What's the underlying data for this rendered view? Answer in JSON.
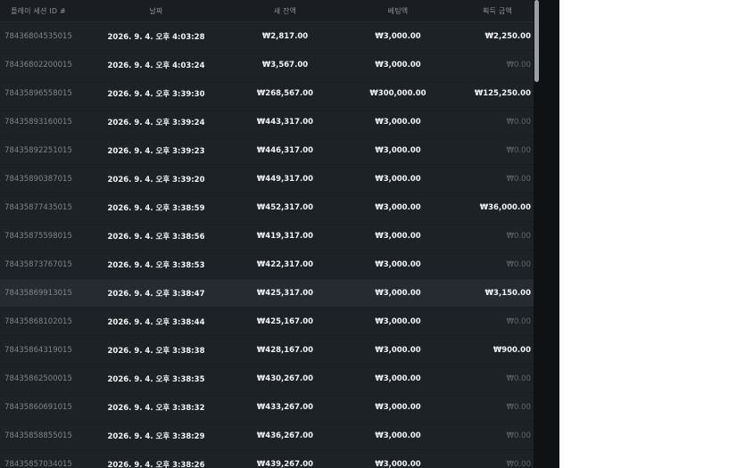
{
  "table": {
    "headers": {
      "id": "플레이 세션 ID #",
      "date": "날짜",
      "balance": "새 잔액",
      "bet": "베팅액",
      "win": "획득 금액"
    },
    "rows": [
      {
        "id": "78436804535015",
        "date": "2026. 9. 4. 오후 4:03:28",
        "balance": "₩2,817.00",
        "bet": "₩3,000.00",
        "win": "₩2,250.00"
      },
      {
        "id": "78436802200015",
        "date": "2026. 9. 4. 오후 4:03:24",
        "balance": "₩3,567.00",
        "bet": "₩3,000.00",
        "win": "₩0.00"
      },
      {
        "id": "78435896558015",
        "date": "2026. 9. 4. 오후 3:39:30",
        "balance": "₩268,567.00",
        "bet": "₩300,000.00",
        "win": "₩125,250.00"
      },
      {
        "id": "78435893160015",
        "date": "2026. 9. 4. 오후 3:39:24",
        "balance": "₩443,317.00",
        "bet": "₩3,000.00",
        "win": "₩0.00"
      },
      {
        "id": "78435892251015",
        "date": "2026. 9. 4. 오후 3:39:23",
        "balance": "₩446,317.00",
        "bet": "₩3,000.00",
        "win": "₩0.00"
      },
      {
        "id": "78435890387015",
        "date": "2026. 9. 4. 오후 3:39:20",
        "balance": "₩449,317.00",
        "bet": "₩3,000.00",
        "win": "₩0.00"
      },
      {
        "id": "78435877435015",
        "date": "2026. 9. 4. 오후 3:38:59",
        "balance": "₩452,317.00",
        "bet": "₩3,000.00",
        "win": "₩36,000.00"
      },
      {
        "id": "78435875598015",
        "date": "2026. 9. 4. 오후 3:38:56",
        "balance": "₩419,317.00",
        "bet": "₩3,000.00",
        "win": "₩0.00"
      },
      {
        "id": "78435873767015",
        "date": "2026. 9. 4. 오후 3:38:53",
        "balance": "₩422,317.00",
        "bet": "₩3,000.00",
        "win": "₩0.00"
      },
      {
        "id": "78435869913015",
        "date": "2026. 9. 4. 오후 3:38:47",
        "balance": "₩425,317.00",
        "bet": "₩3,000.00",
        "win": "₩3,150.00"
      },
      {
        "id": "78435868102015",
        "date": "2026. 9. 4. 오후 3:38:44",
        "balance": "₩425,167.00",
        "bet": "₩3,000.00",
        "win": "₩0.00"
      },
      {
        "id": "78435864319015",
        "date": "2026. 9. 4. 오후 3:38:38",
        "balance": "₩428,167.00",
        "bet": "₩3,000.00",
        "win": "₩900.00"
      },
      {
        "id": "78435862500015",
        "date": "2026. 9. 4. 오후 3:38:35",
        "balance": "₩430,267.00",
        "bet": "₩3,000.00",
        "win": "₩0.00"
      },
      {
        "id": "78435860691015",
        "date": "2026. 9. 4. 오후 3:38:32",
        "balance": "₩433,267.00",
        "bet": "₩3,000.00",
        "win": "₩0.00"
      },
      {
        "id": "78435858855015",
        "date": "2026. 9. 4. 오후 3:38:29",
        "balance": "₩436,267.00",
        "bet": "₩3,000.00",
        "win": "₩0.00"
      },
      {
        "id": "78435857034015",
        "date": "2026. 9. 4. 오후 3:38:26",
        "balance": "₩439,267.00",
        "bet": "₩3,000.00",
        "win": "₩0.00"
      }
    ]
  },
  "colors": {
    "background": "#1d2226",
    "text": "#f1f3f5",
    "muted": "#7c858d",
    "zero": "#5f676e"
  }
}
